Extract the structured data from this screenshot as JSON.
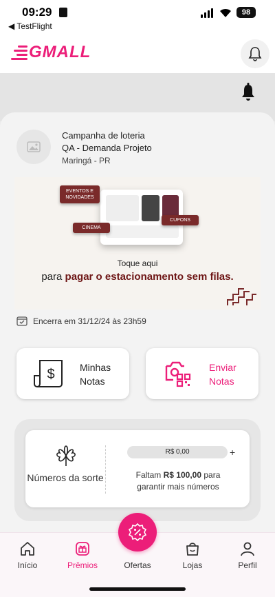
{
  "status_bar": {
    "time": "09:29",
    "back_label": "◀ TestFlight",
    "battery": "98"
  },
  "header": {
    "logo_text": "GMALL",
    "brand_color": "#ec1e79"
  },
  "campaign": {
    "title": "Campanha de loteria",
    "subtitle": "QA - Demanda Projeto",
    "location": "Maringá - PR",
    "ends": "Encerra em 31/12/24 às 23h59"
  },
  "banner": {
    "tags": [
      "EVENTOS E NOVIDADES",
      "CINEMA",
      "CUPONS"
    ],
    "line1": "Toque aqui",
    "line2_prefix": "para ",
    "line2_bold": "pagar o estacionamento sem filas."
  },
  "actions": {
    "minhas_notas": "Minhas Notas",
    "enviar_notas": "Enviar Notas"
  },
  "lucky": {
    "label": "Números da sorte",
    "progress_value": "R$ 0,00",
    "progress_fraction": 0,
    "plus": "+",
    "msg_prefix": "Faltam ",
    "msg_amount": "R$ 100,00",
    "msg_suffix": " para garantir mais números"
  },
  "tabs": [
    {
      "label": "Início",
      "icon": "home-icon"
    },
    {
      "label": "Prêmios",
      "icon": "gift-icon",
      "active": true
    },
    {
      "label": "Ofertas",
      "icon": "discount-icon"
    },
    {
      "label": "Lojas",
      "icon": "shopping-bag-icon"
    },
    {
      "label": "Perfil",
      "icon": "user-icon"
    }
  ]
}
